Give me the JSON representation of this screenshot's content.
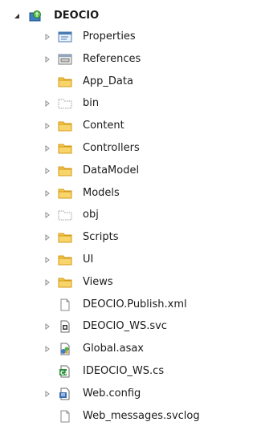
{
  "tree": {
    "root": {
      "label": "DEOCIO",
      "icon": "web-project-icon"
    },
    "items": [
      {
        "label": "Properties",
        "icon": "properties-icon",
        "expandable": true
      },
      {
        "label": "References",
        "icon": "references-icon",
        "expandable": true
      },
      {
        "label": "App_Data",
        "icon": "folder-icon",
        "expandable": false
      },
      {
        "label": "bin",
        "icon": "hidden-folder-icon",
        "expandable": true
      },
      {
        "label": "Content",
        "icon": "folder-icon",
        "expandable": true
      },
      {
        "label": "Controllers",
        "icon": "folder-icon",
        "expandable": true
      },
      {
        "label": "DataModel",
        "icon": "folder-icon",
        "expandable": true
      },
      {
        "label": "Models",
        "icon": "folder-icon",
        "expandable": true
      },
      {
        "label": "obj",
        "icon": "hidden-folder-icon",
        "expandable": true
      },
      {
        "label": "Scripts",
        "icon": "folder-icon",
        "expandable": true
      },
      {
        "label": "UI",
        "icon": "folder-icon",
        "expandable": true
      },
      {
        "label": "Views",
        "icon": "folder-icon",
        "expandable": true
      },
      {
        "label": "DEOCIO.Publish.xml",
        "icon": "file-icon",
        "expandable": false
      },
      {
        "label": "DEOCIO_WS.svc",
        "icon": "svc-file-icon",
        "expandable": true
      },
      {
        "label": "Global.asax",
        "icon": "asax-file-icon",
        "expandable": true
      },
      {
        "label": "IDEOCIO_WS.cs",
        "icon": "csharp-file-icon",
        "expandable": false
      },
      {
        "label": "Web.config",
        "icon": "config-file-icon",
        "expandable": true
      },
      {
        "label": "Web_messages.svclog",
        "icon": "file-icon",
        "expandable": false
      }
    ]
  },
  "colors": {
    "folder": "#f3c74f",
    "folder_dark": "#d49a16",
    "arrow": "#8c8c8c"
  }
}
